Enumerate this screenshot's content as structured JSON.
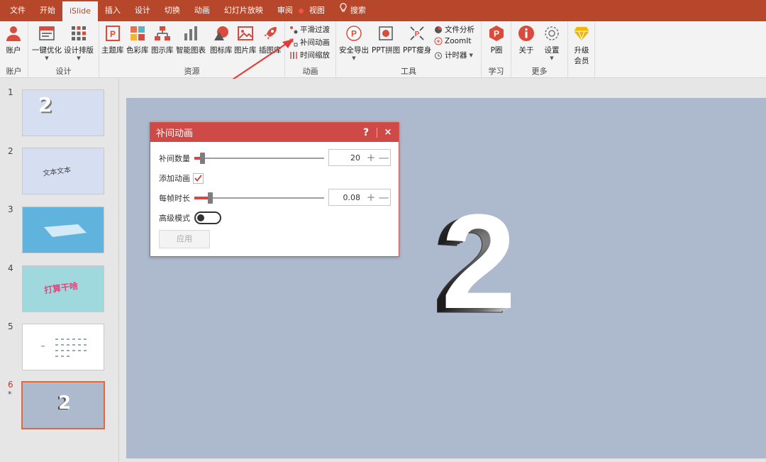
{
  "tabs": [
    {
      "label": "文件"
    },
    {
      "label": "开始"
    },
    {
      "label": "iSlide"
    },
    {
      "label": "插入"
    },
    {
      "label": "设计"
    },
    {
      "label": "切换"
    },
    {
      "label": "动画"
    },
    {
      "label": "幻灯片放映"
    },
    {
      "label": "审阅"
    },
    {
      "label": "视图"
    },
    {
      "label": "搜索"
    }
  ],
  "active_tab": "iSlide",
  "ribbon": {
    "groups": {
      "account": "账户",
      "design": "设计",
      "resources": "资源",
      "animation": "动画",
      "tools": "工具",
      "learn": "学习",
      "more": "更多"
    },
    "buttons": {
      "account": "账户",
      "one_click": "一键优化",
      "design_layout": "设计排版",
      "theme_lib": "主题库",
      "color_lib": "色彩库",
      "diagram_lib": "图示库",
      "smart_chart": "智能图表",
      "icon_lib": "图标库",
      "image_lib": "图片库",
      "illus_lib": "插图库",
      "smooth": "平滑过渡",
      "tween": "补间动画",
      "timescale": "时间缩放",
      "safe_export": "安全导出",
      "ppt_collage": "PPT拼图",
      "ppt_slim": "PPT瘦身",
      "file_analysis": "文件分析",
      "zoomit": "ZoomIt",
      "timer": "计时器",
      "p_circle": "P圈",
      "about": "关于",
      "settings": "设置",
      "upgrade_line1": "升级",
      "upgrade_line2": "会员"
    }
  },
  "slides": [
    {
      "num": "1",
      "text": "2"
    },
    {
      "num": "2",
      "text": "文本文本"
    },
    {
      "num": "3",
      "text": ""
    },
    {
      "num": "4",
      "text": "打算干啥"
    },
    {
      "num": "5",
      "text": ""
    },
    {
      "num": "6",
      "text": "2",
      "star": "*"
    }
  ],
  "current_slide": {
    "big_text": "2"
  },
  "dialog": {
    "title": "补间动画",
    "help": "?",
    "close": "×",
    "tween_count_label": "补间数量",
    "tween_count_value": "20",
    "tween_count_fraction": 0.02,
    "add_anim_label": "添加动画",
    "add_anim_checked": true,
    "frame_duration_label": "每帧时长",
    "frame_duration_value": "0.08",
    "frame_duration_fraction": 0.08,
    "advanced_label": "高级模式",
    "advanced_on": false,
    "apply_label": "应用",
    "plus": "+",
    "minus": "—"
  },
  "colors": {
    "accent": "#b7472a",
    "dialog_red": "#cf4a47",
    "slide_bg": "#adb9cc"
  }
}
